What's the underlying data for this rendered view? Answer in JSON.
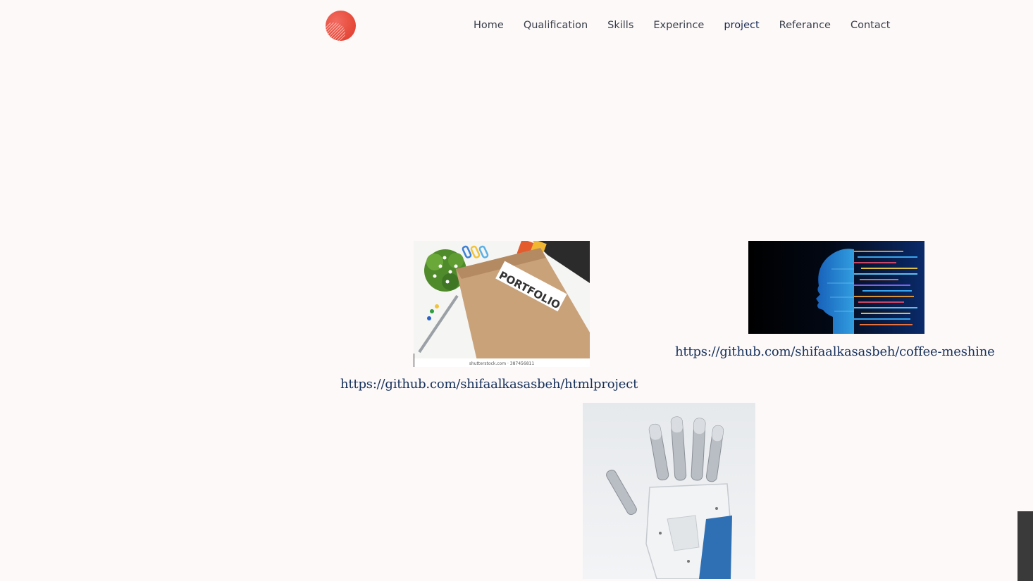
{
  "nav": {
    "items": [
      {
        "label": "Home"
      },
      {
        "label": "Qualification"
      },
      {
        "label": "Skills"
      },
      {
        "label": "Experince"
      },
      {
        "label": "project"
      },
      {
        "label": "Referance"
      },
      {
        "label": "Contact"
      }
    ],
    "active_index": 4
  },
  "projects": [
    {
      "image_icon": "portfolio-notebook-image",
      "image_text": "PORTFOLIO",
      "image_caption": "shutterstock.com · 387456811",
      "link": "https://github.com/shifaalkasasbeh/htmlproject"
    },
    {
      "image_icon": "ai-head-code-image",
      "link": "https://github.com/shifaalkasasbeh/coffee-meshine"
    },
    {
      "image_icon": "robotic-hand-image"
    }
  ],
  "colors": {
    "background": "#fdf9f9",
    "logo": "#e74c3c",
    "nav_text": "#3a3f4a",
    "link_text": "#15305a"
  }
}
